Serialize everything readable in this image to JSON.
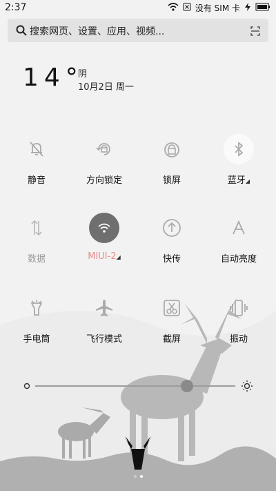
{
  "status": {
    "time": "2:37",
    "sim": "没有 SIM 卡"
  },
  "search": {
    "placeholder": "搜索网页、设置、应用、视频..."
  },
  "weather": {
    "temperature": "14°",
    "condition": "阴",
    "date": "10月2日 周一"
  },
  "tiles": [
    {
      "label": "静音",
      "icon": "bell-off-icon"
    },
    {
      "label": "方向锁定",
      "icon": "rotation-lock-icon"
    },
    {
      "label": "锁屏",
      "icon": "lock-icon"
    },
    {
      "label": "蓝牙",
      "icon": "bluetooth-icon"
    },
    {
      "label": "数据",
      "icon": "mobile-data-icon"
    },
    {
      "label": "MIUI-2",
      "icon": "wifi-icon"
    },
    {
      "label": "快传",
      "icon": "transfer-icon"
    },
    {
      "label": "自动亮度",
      "icon": "auto-brightness-icon"
    },
    {
      "label": "手电筒",
      "icon": "flashlight-icon"
    },
    {
      "label": "飞行模式",
      "icon": "airplane-icon"
    },
    {
      "label": "截屏",
      "icon": "screenshot-icon"
    },
    {
      "label": "振动",
      "icon": "vibrate-icon"
    }
  ],
  "brightness": {
    "level": 0.76
  },
  "colors": {
    "wifi_active": "#6f6f6f",
    "wifi_label": "#ee8b8b"
  }
}
